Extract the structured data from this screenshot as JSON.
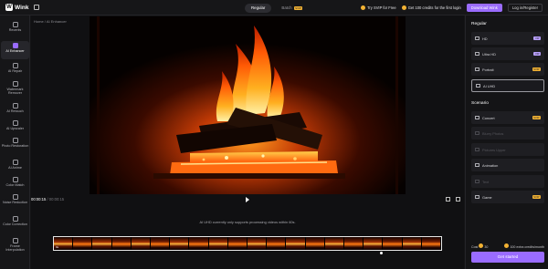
{
  "app": {
    "logo_letter": "W",
    "name": "Wink"
  },
  "header": {
    "modes": [
      {
        "label": "Regular",
        "badge": ""
      },
      {
        "label": "Batch",
        "badge": "SVIP"
      }
    ],
    "promo_svip": "Try SVIP for Free",
    "promo_credits": "Get 100 credits for the first login",
    "download_label": "Download Wink",
    "login_label": "Log in/Register"
  },
  "sidebar": {
    "items": [
      {
        "label": "Recents"
      },
      {
        "label": "AI Enhancer"
      },
      {
        "label": "AI Repair"
      },
      {
        "label": "Watermark Remover"
      },
      {
        "label": "AI Retouch"
      },
      {
        "label": "AI Upscaler"
      },
      {
        "label": "Photo Restoration"
      },
      {
        "label": "AI Anime"
      },
      {
        "label": "Color Match"
      },
      {
        "label": "Noise Reduction"
      },
      {
        "label": "Color Correction"
      },
      {
        "label": "Frame Interpolation"
      }
    ]
  },
  "breadcrumb": {
    "home": "Home",
    "sep": "/",
    "current": "AI Enhancer"
  },
  "player": {
    "current_time": "00:00:15",
    "total_time": "/ 00:00:15",
    "notice": "AI UHD currently only supports processing videos within 60s.",
    "timeline_start": "0s"
  },
  "panel": {
    "regular_title": "Regular",
    "regular": [
      {
        "label": "HD",
        "badge": "VIP",
        "badge_type": "vip",
        "state": "normal"
      },
      {
        "label": "Ultra HD",
        "badge": "VIP",
        "badge_type": "vip",
        "state": "normal"
      },
      {
        "label": "Portrait",
        "badge": "SVIP",
        "badge_type": "svip",
        "state": "normal"
      },
      {
        "label": "AI UHD",
        "badge": "",
        "badge_type": "",
        "state": "active"
      }
    ],
    "scenario_title": "Scenario",
    "scenario": [
      {
        "label": "Concert",
        "badge": "SVIP",
        "badge_type": "svip",
        "state": "normal"
      },
      {
        "label": "Blurry Photos",
        "badge": "",
        "badge_type": "",
        "state": "disabled"
      },
      {
        "label": "Pictures Upper",
        "badge": "",
        "badge_type": "",
        "state": "disabled"
      },
      {
        "label": "Animation",
        "badge": "",
        "badge_type": "",
        "state": "normal"
      },
      {
        "label": "Text",
        "badge": "",
        "badge_type": "",
        "state": "disabled"
      },
      {
        "label": "Game",
        "badge": "SVIP",
        "badge_type": "svip",
        "state": "normal"
      }
    ],
    "cost_label": "Cost",
    "cost_value": "30",
    "credits_info": "100 extra credits/month",
    "start_label": "Get started"
  }
}
